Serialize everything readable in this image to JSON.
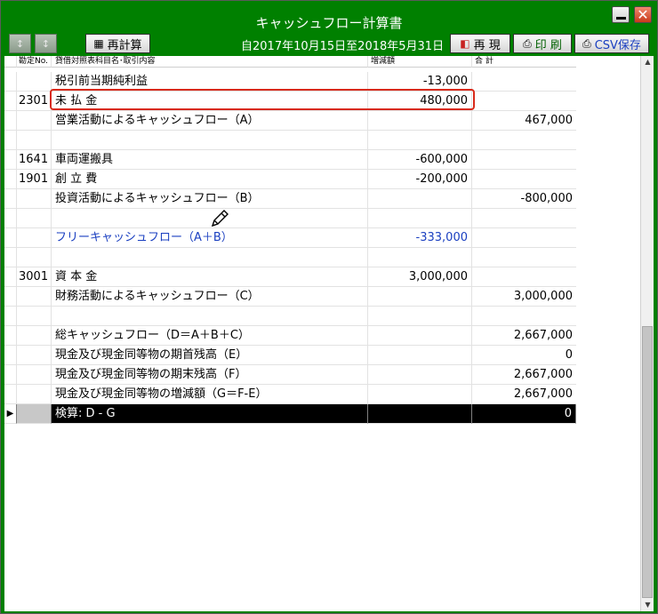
{
  "window": {
    "title": "キャッシュフロー計算書"
  },
  "toolbar": {
    "sort_asc_label": "↕",
    "sort_desc_label": "↕",
    "recalc_label": "再計算",
    "period": "自2017年10月15日至2018年5月31日",
    "replay_label": "再 現",
    "print_label": "印 刷",
    "csv_label": "CSV保存"
  },
  "table": {
    "headers": {
      "code": "勘定No.",
      "name": "貸借対照表科目名･取引内容",
      "diff": "増減額",
      "total": "合 計"
    },
    "rows": [
      {
        "code": "",
        "name": "税引前当期純利益",
        "diff": "-13,000",
        "total": ""
      },
      {
        "code": "2301",
        "name": "未 払 金",
        "diff": "480,000",
        "total": ""
      },
      {
        "code": "",
        "name": "営業活動によるキャッシュフロー（A）",
        "diff": "",
        "total": "467,000"
      },
      {
        "code": "",
        "name": "",
        "diff": "",
        "total": ""
      },
      {
        "code": "1641",
        "name": "車両運搬具",
        "diff": "-600,000",
        "total": ""
      },
      {
        "code": "1901",
        "name": "創 立 費",
        "diff": "-200,000",
        "total": ""
      },
      {
        "code": "",
        "name": "投資活動によるキャッシュフロー（B）",
        "diff": "",
        "total": "-800,000"
      },
      {
        "code": "",
        "name": "",
        "diff": "",
        "total": ""
      },
      {
        "code": "",
        "name": "フリーキャッシュフロー（A＋B）",
        "diff": "-333,000",
        "total": ""
      },
      {
        "code": "",
        "name": "",
        "diff": "",
        "total": ""
      },
      {
        "code": "3001",
        "name": "資 本 金",
        "diff": "3,000,000",
        "total": ""
      },
      {
        "code": "",
        "name": "財務活動によるキャッシュフロー（C）",
        "diff": "",
        "total": "3,000,000"
      },
      {
        "code": "",
        "name": "",
        "diff": "",
        "total": ""
      },
      {
        "code": "",
        "name": "総キャッシュフロー（D＝A＋B＋C）",
        "diff": "",
        "total": "2,667,000"
      },
      {
        "code": "",
        "name": "現金及び現金同等物の期首残高（E）",
        "diff": "",
        "total": "0"
      },
      {
        "code": "",
        "name": "現金及び現金同等物の期末残高（F）",
        "diff": "",
        "total": "2,667,000"
      },
      {
        "code": "",
        "name": "現金及び現金同等物の増減額（G＝F-E）",
        "diff": "",
        "total": "2,667,000"
      }
    ],
    "check_row": {
      "indicator": "▶",
      "name": "検算: D - G",
      "diff": "",
      "total": "0"
    }
  },
  "colors": {
    "titlebar": "#008000",
    "highlight_border": "#d82a1a",
    "free_cf_text": "#1a3fc0"
  }
}
